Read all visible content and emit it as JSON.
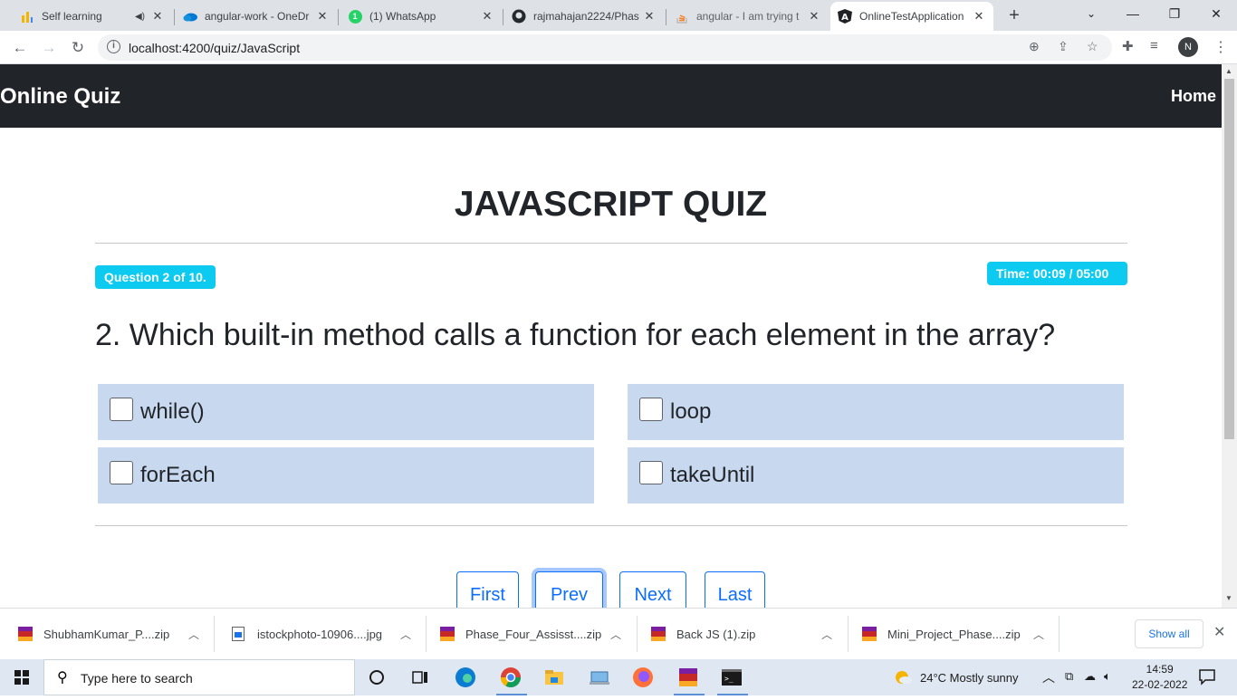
{
  "browser": {
    "tabs": [
      {
        "label": "Self learning",
        "icon": "chart-bars-icon",
        "close": "✕"
      },
      {
        "label": "angular-work - OneDr",
        "icon": "onedrive-cloud-icon",
        "close": "✕"
      },
      {
        "label": "(1) WhatsApp",
        "icon": "whatsapp-icon",
        "close": "✕",
        "badge": "1"
      },
      {
        "label": "rajmahajan2224/Phas",
        "icon": "github-icon",
        "close": "✕"
      },
      {
        "label": "angular - I am trying t",
        "icon": "stackoverflow-icon",
        "close": "✕"
      },
      {
        "label": "OnlineTestApplication",
        "icon": "angular-icon",
        "close": "✕"
      }
    ],
    "url": "localhost:4200/quiz/JavaScript",
    "profile_initial": "N"
  },
  "page": {
    "brand": "Online Quiz",
    "nav_home": "Home",
    "quiz_title": "JAVASCRIPT QUIZ",
    "question_badge": "Question 2 of 10.",
    "timer_badge": "Time: 00:09 / 05:00",
    "question_text": "2. Which built-in method calls a function for each element in the array?",
    "options": [
      {
        "label": "while()"
      },
      {
        "label": "loop"
      },
      {
        "label": "forEach"
      },
      {
        "label": "takeUntil"
      }
    ],
    "pagination": {
      "first": "First",
      "prev": "Prev",
      "next": "Next",
      "last": "Last"
    },
    "colors": {
      "navbar": "#212529",
      "badge": "#0dcaf0",
      "option_bg": "#c8d9ef",
      "primary": "#0d6efd"
    }
  },
  "downloads": {
    "items": [
      {
        "name": "ShubhamKumar_P....zip",
        "icon": "winrar-icon"
      },
      {
        "name": "istockphoto-10906....jpg",
        "icon": "image-file-icon"
      },
      {
        "name": "Phase_Four_Assisst....zip",
        "icon": "winrar-icon"
      },
      {
        "name": "Back JS (1).zip",
        "icon": "winrar-icon"
      },
      {
        "name": "Mini_Project_Phase....zip",
        "icon": "winrar-icon"
      }
    ],
    "show_all": "Show all"
  },
  "taskbar": {
    "search_placeholder": "Type here to search",
    "weather": "24°C  Mostly sunny",
    "time": "14:59",
    "date": "22-02-2022"
  }
}
